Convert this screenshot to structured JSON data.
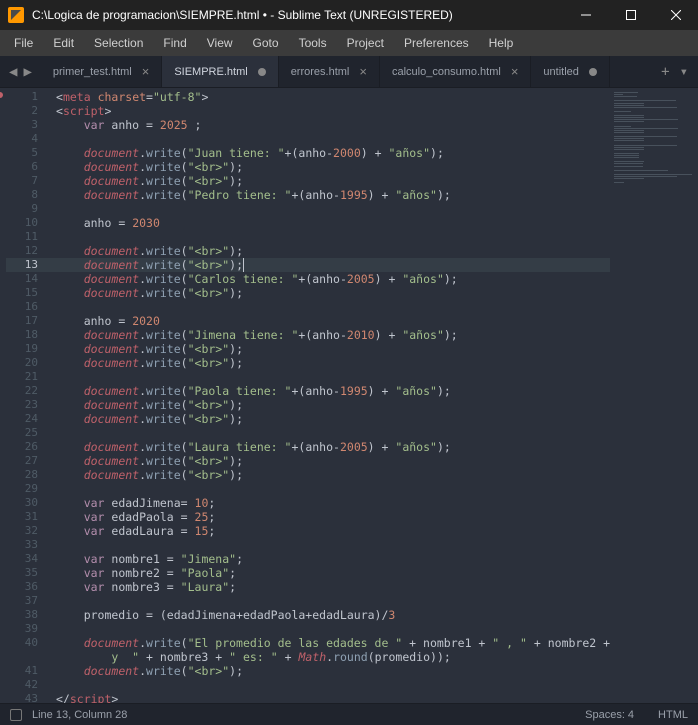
{
  "titlebar": {
    "title": "C:\\Logica de programacion\\SIEMPRE.html • - Sublime Text (UNREGISTERED)"
  },
  "menu": [
    "File",
    "Edit",
    "Selection",
    "Find",
    "View",
    "Goto",
    "Tools",
    "Project",
    "Preferences",
    "Help"
  ],
  "tabs": [
    {
      "label": "primer_test.html",
      "active": false,
      "dirty": false
    },
    {
      "label": "SIEMPRE.html",
      "active": true,
      "dirty": true
    },
    {
      "label": "errores.html",
      "active": false,
      "dirty": false
    },
    {
      "label": "calculo_consumo.html",
      "active": false,
      "dirty": false
    },
    {
      "label": "untitled",
      "active": false,
      "dirty": true
    }
  ],
  "active_line": 13,
  "status": {
    "position": "Line 13, Column 28",
    "spaces": "Spaces: 4",
    "syntax": "HTML"
  },
  "code": [
    {
      "n": 1,
      "seg": [
        [
          "<",
          "pun"
        ],
        [
          "meta",
          "tag"
        ],
        [
          " ",
          "pun"
        ],
        [
          "charset",
          "attr"
        ],
        [
          "=",
          "op"
        ],
        [
          "\"utf-8\"",
          "str"
        ],
        [
          ">",
          "pun"
        ]
      ]
    },
    {
      "n": 2,
      "seg": [
        [
          "<",
          "pun"
        ],
        [
          "script",
          "tag"
        ],
        [
          ">",
          "pun"
        ]
      ]
    },
    {
      "n": 3,
      "seg": [
        [
          "    ",
          "pun"
        ],
        [
          "var",
          "kw"
        ],
        [
          " anho ",
          "var"
        ],
        [
          "=",
          "op"
        ],
        [
          " ",
          "pun"
        ],
        [
          "2025",
          "num"
        ],
        [
          " ;",
          "pun"
        ]
      ]
    },
    {
      "n": 4,
      "seg": []
    },
    {
      "n": 5,
      "seg": [
        [
          "    ",
          "pun"
        ],
        [
          "document",
          "obj"
        ],
        [
          ".",
          "pun"
        ],
        [
          "write",
          "func"
        ],
        [
          "(",
          "pun"
        ],
        [
          "\"Juan tiene: \"",
          "str"
        ],
        [
          "+",
          "op"
        ],
        [
          "(",
          "pun"
        ],
        [
          "anho",
          "var"
        ],
        [
          "-",
          "op"
        ],
        [
          "2000",
          "num"
        ],
        [
          ") ",
          "pun"
        ],
        [
          "+",
          "op"
        ],
        [
          " ",
          "pun"
        ],
        [
          "\"años\"",
          "str"
        ],
        [
          ");",
          "pun"
        ]
      ]
    },
    {
      "n": 6,
      "seg": [
        [
          "    ",
          "pun"
        ],
        [
          "document",
          "obj"
        ],
        [
          ".",
          "pun"
        ],
        [
          "write",
          "func"
        ],
        [
          "(",
          "pun"
        ],
        [
          "\"<br>\"",
          "str"
        ],
        [
          ");",
          "pun"
        ]
      ]
    },
    {
      "n": 7,
      "seg": [
        [
          "    ",
          "pun"
        ],
        [
          "document",
          "obj"
        ],
        [
          ".",
          "pun"
        ],
        [
          "write",
          "func"
        ],
        [
          "(",
          "pun"
        ],
        [
          "\"<br>\"",
          "str"
        ],
        [
          ");",
          "pun"
        ]
      ]
    },
    {
      "n": 8,
      "seg": [
        [
          "    ",
          "pun"
        ],
        [
          "document",
          "obj"
        ],
        [
          ".",
          "pun"
        ],
        [
          "write",
          "func"
        ],
        [
          "(",
          "pun"
        ],
        [
          "\"Pedro tiene: \"",
          "str"
        ],
        [
          "+",
          "op"
        ],
        [
          "(",
          "pun"
        ],
        [
          "anho",
          "var"
        ],
        [
          "-",
          "op"
        ],
        [
          "1995",
          "num"
        ],
        [
          ") ",
          "pun"
        ],
        [
          "+",
          "op"
        ],
        [
          " ",
          "pun"
        ],
        [
          "\"años\"",
          "str"
        ],
        [
          ");",
          "pun"
        ]
      ]
    },
    {
      "n": 9,
      "seg": []
    },
    {
      "n": 10,
      "seg": [
        [
          "    anho ",
          "var"
        ],
        [
          "=",
          "op"
        ],
        [
          " ",
          "pun"
        ],
        [
          "2030",
          "num"
        ]
      ]
    },
    {
      "n": 11,
      "seg": []
    },
    {
      "n": 12,
      "seg": [
        [
          "    ",
          "pun"
        ],
        [
          "document",
          "obj"
        ],
        [
          ".",
          "pun"
        ],
        [
          "write",
          "func"
        ],
        [
          "(",
          "pun"
        ],
        [
          "\"<br>\"",
          "str"
        ],
        [
          ");",
          "pun"
        ]
      ]
    },
    {
      "n": 13,
      "seg": [
        [
          "    ",
          "pun"
        ],
        [
          "document",
          "obj"
        ],
        [
          ".",
          "pun"
        ],
        [
          "write",
          "func"
        ],
        [
          "(",
          "pun"
        ],
        [
          "\"<br>\"",
          "str"
        ],
        [
          ");",
          "pun"
        ],
        [
          "",
          "caret"
        ]
      ]
    },
    {
      "n": 14,
      "seg": [
        [
          "    ",
          "pun"
        ],
        [
          "document",
          "obj"
        ],
        [
          ".",
          "pun"
        ],
        [
          "write",
          "func"
        ],
        [
          "(",
          "pun"
        ],
        [
          "\"Carlos tiene: \"",
          "str"
        ],
        [
          "+",
          "op"
        ],
        [
          "(",
          "pun"
        ],
        [
          "anho",
          "var"
        ],
        [
          "-",
          "op"
        ],
        [
          "2005",
          "num"
        ],
        [
          ") ",
          "pun"
        ],
        [
          "+",
          "op"
        ],
        [
          " ",
          "pun"
        ],
        [
          "\"años\"",
          "str"
        ],
        [
          ");",
          "pun"
        ]
      ]
    },
    {
      "n": 15,
      "seg": [
        [
          "    ",
          "pun"
        ],
        [
          "document",
          "obj"
        ],
        [
          ".",
          "pun"
        ],
        [
          "write",
          "func"
        ],
        [
          "(",
          "pun"
        ],
        [
          "\"<br>\"",
          "str"
        ],
        [
          ");",
          "pun"
        ]
      ]
    },
    {
      "n": 16,
      "seg": []
    },
    {
      "n": 17,
      "seg": [
        [
          "    anho ",
          "var"
        ],
        [
          "=",
          "op"
        ],
        [
          " ",
          "pun"
        ],
        [
          "2020",
          "num"
        ]
      ]
    },
    {
      "n": 18,
      "seg": [
        [
          "    ",
          "pun"
        ],
        [
          "document",
          "obj"
        ],
        [
          ".",
          "pun"
        ],
        [
          "write",
          "func"
        ],
        [
          "(",
          "pun"
        ],
        [
          "\"Jimena tiene: \"",
          "str"
        ],
        [
          "+",
          "op"
        ],
        [
          "(",
          "pun"
        ],
        [
          "anho",
          "var"
        ],
        [
          "-",
          "op"
        ],
        [
          "2010",
          "num"
        ],
        [
          ") ",
          "pun"
        ],
        [
          "+",
          "op"
        ],
        [
          " ",
          "pun"
        ],
        [
          "\"años\"",
          "str"
        ],
        [
          ");",
          "pun"
        ]
      ]
    },
    {
      "n": 19,
      "seg": [
        [
          "    ",
          "pun"
        ],
        [
          "document",
          "obj"
        ],
        [
          ".",
          "pun"
        ],
        [
          "write",
          "func"
        ],
        [
          "(",
          "pun"
        ],
        [
          "\"<br>\"",
          "str"
        ],
        [
          ");",
          "pun"
        ]
      ]
    },
    {
      "n": 20,
      "seg": [
        [
          "    ",
          "pun"
        ],
        [
          "document",
          "obj"
        ],
        [
          ".",
          "pun"
        ],
        [
          "write",
          "func"
        ],
        [
          "(",
          "pun"
        ],
        [
          "\"<br>\"",
          "str"
        ],
        [
          ");",
          "pun"
        ]
      ]
    },
    {
      "n": 21,
      "seg": []
    },
    {
      "n": 22,
      "seg": [
        [
          "    ",
          "pun"
        ],
        [
          "document",
          "obj"
        ],
        [
          ".",
          "pun"
        ],
        [
          "write",
          "func"
        ],
        [
          "(",
          "pun"
        ],
        [
          "\"Paola tiene: \"",
          "str"
        ],
        [
          "+",
          "op"
        ],
        [
          "(",
          "pun"
        ],
        [
          "anho",
          "var"
        ],
        [
          "-",
          "op"
        ],
        [
          "1995",
          "num"
        ],
        [
          ") ",
          "pun"
        ],
        [
          "+",
          "op"
        ],
        [
          " ",
          "pun"
        ],
        [
          "\"años\"",
          "str"
        ],
        [
          ");",
          "pun"
        ]
      ]
    },
    {
      "n": 23,
      "seg": [
        [
          "    ",
          "pun"
        ],
        [
          "document",
          "obj"
        ],
        [
          ".",
          "pun"
        ],
        [
          "write",
          "func"
        ],
        [
          "(",
          "pun"
        ],
        [
          "\"<br>\"",
          "str"
        ],
        [
          ");",
          "pun"
        ]
      ]
    },
    {
      "n": 24,
      "seg": [
        [
          "    ",
          "pun"
        ],
        [
          "document",
          "obj"
        ],
        [
          ".",
          "pun"
        ],
        [
          "write",
          "func"
        ],
        [
          "(",
          "pun"
        ],
        [
          "\"<br>\"",
          "str"
        ],
        [
          ");",
          "pun"
        ]
      ]
    },
    {
      "n": 25,
      "seg": []
    },
    {
      "n": 26,
      "seg": [
        [
          "    ",
          "pun"
        ],
        [
          "document",
          "obj"
        ],
        [
          ".",
          "pun"
        ],
        [
          "write",
          "func"
        ],
        [
          "(",
          "pun"
        ],
        [
          "\"Laura tiene: \"",
          "str"
        ],
        [
          "+",
          "op"
        ],
        [
          "(",
          "pun"
        ],
        [
          "anho",
          "var"
        ],
        [
          "-",
          "op"
        ],
        [
          "2005",
          "num"
        ],
        [
          ") ",
          "pun"
        ],
        [
          "+",
          "op"
        ],
        [
          " ",
          "pun"
        ],
        [
          "\"años\"",
          "str"
        ],
        [
          ");",
          "pun"
        ]
      ]
    },
    {
      "n": 27,
      "seg": [
        [
          "    ",
          "pun"
        ],
        [
          "document",
          "obj"
        ],
        [
          ".",
          "pun"
        ],
        [
          "write",
          "func"
        ],
        [
          "(",
          "pun"
        ],
        [
          "\"<br>\"",
          "str"
        ],
        [
          ");",
          "pun"
        ]
      ]
    },
    {
      "n": 28,
      "seg": [
        [
          "    ",
          "pun"
        ],
        [
          "document",
          "obj"
        ],
        [
          ".",
          "pun"
        ],
        [
          "write",
          "func"
        ],
        [
          "(",
          "pun"
        ],
        [
          "\"<br>\"",
          "str"
        ],
        [
          ");",
          "pun"
        ]
      ]
    },
    {
      "n": 29,
      "seg": []
    },
    {
      "n": 30,
      "seg": [
        [
          "    ",
          "pun"
        ],
        [
          "var",
          "kw"
        ],
        [
          " edadJimena",
          "var"
        ],
        [
          "=",
          "op"
        ],
        [
          " ",
          "pun"
        ],
        [
          "10",
          "num"
        ],
        [
          ";",
          "pun"
        ]
      ]
    },
    {
      "n": 31,
      "seg": [
        [
          "    ",
          "pun"
        ],
        [
          "var",
          "kw"
        ],
        [
          " edadPaola ",
          "var"
        ],
        [
          "=",
          "op"
        ],
        [
          " ",
          "pun"
        ],
        [
          "25",
          "num"
        ],
        [
          ";",
          "pun"
        ]
      ]
    },
    {
      "n": 32,
      "seg": [
        [
          "    ",
          "pun"
        ],
        [
          "var",
          "kw"
        ],
        [
          " edadLaura ",
          "var"
        ],
        [
          "=",
          "op"
        ],
        [
          " ",
          "pun"
        ],
        [
          "15",
          "num"
        ],
        [
          ";",
          "pun"
        ]
      ]
    },
    {
      "n": 33,
      "seg": []
    },
    {
      "n": 34,
      "seg": [
        [
          "    ",
          "pun"
        ],
        [
          "var",
          "kw"
        ],
        [
          " nombre1 ",
          "var"
        ],
        [
          "=",
          "op"
        ],
        [
          " ",
          "pun"
        ],
        [
          "\"Jimena\"",
          "str"
        ],
        [
          ";",
          "pun"
        ]
      ]
    },
    {
      "n": 35,
      "seg": [
        [
          "    ",
          "pun"
        ],
        [
          "var",
          "kw"
        ],
        [
          " nombre2 ",
          "var"
        ],
        [
          "=",
          "op"
        ],
        [
          " ",
          "pun"
        ],
        [
          "\"Paola\"",
          "str"
        ],
        [
          ";",
          "pun"
        ]
      ]
    },
    {
      "n": 36,
      "seg": [
        [
          "    ",
          "pun"
        ],
        [
          "var",
          "kw"
        ],
        [
          " nombre3 ",
          "var"
        ],
        [
          "=",
          "op"
        ],
        [
          " ",
          "pun"
        ],
        [
          "\"Laura\"",
          "str"
        ],
        [
          ";",
          "pun"
        ]
      ]
    },
    {
      "n": 37,
      "seg": []
    },
    {
      "n": 38,
      "seg": [
        [
          "    promedio ",
          "var"
        ],
        [
          "=",
          "op"
        ],
        [
          " (edadJimena",
          "var"
        ],
        [
          "+",
          "op"
        ],
        [
          "edadPaola",
          "var"
        ],
        [
          "+",
          "op"
        ],
        [
          "edadLaura)",
          "var"
        ],
        [
          "/",
          "op"
        ],
        [
          "3",
          "num"
        ]
      ]
    },
    {
      "n": 39,
      "seg": []
    },
    {
      "n": 40,
      "seg": [
        [
          "    ",
          "pun"
        ],
        [
          "document",
          "obj"
        ],
        [
          ".",
          "pun"
        ],
        [
          "write",
          "func"
        ],
        [
          "(",
          "pun"
        ],
        [
          "\"El promedio de las edades de \"",
          "str"
        ],
        [
          " ",
          "pun"
        ],
        [
          "+",
          "op"
        ],
        [
          " nombre1 ",
          "var"
        ],
        [
          "+",
          "op"
        ],
        [
          " ",
          "pun"
        ],
        [
          "\" , \"",
          "str"
        ],
        [
          " ",
          "pun"
        ],
        [
          "+",
          "op"
        ],
        [
          " nombre2 ",
          "var"
        ],
        [
          "+",
          "op"
        ],
        [
          " ",
          "pun"
        ],
        [
          "\"",
          "str"
        ]
      ]
    },
    {
      "n": " ",
      "seg": [
        [
          "        y  \"",
          "str"
        ],
        [
          " ",
          "pun"
        ],
        [
          "+",
          "op"
        ],
        [
          " nombre3 ",
          "var"
        ],
        [
          "+",
          "op"
        ],
        [
          " ",
          "pun"
        ],
        [
          "\" es: \"",
          "str"
        ],
        [
          " ",
          "pun"
        ],
        [
          "+",
          "op"
        ],
        [
          " ",
          "pun"
        ],
        [
          "Math",
          "obj"
        ],
        [
          ".",
          "pun"
        ],
        [
          "round",
          "func"
        ],
        [
          "(promedio));",
          "pun"
        ]
      ]
    },
    {
      "n": 41,
      "seg": [
        [
          "    ",
          "pun"
        ],
        [
          "document",
          "obj"
        ],
        [
          ".",
          "pun"
        ],
        [
          "write",
          "func"
        ],
        [
          "(",
          "pun"
        ],
        [
          "\"<br>\"",
          "str"
        ],
        [
          ");",
          "pun"
        ]
      ]
    },
    {
      "n": 42,
      "seg": []
    },
    {
      "n": 43,
      "seg": [
        [
          "</",
          "pun"
        ],
        [
          "script",
          "tag"
        ],
        [
          ">",
          "pun"
        ]
      ]
    }
  ]
}
